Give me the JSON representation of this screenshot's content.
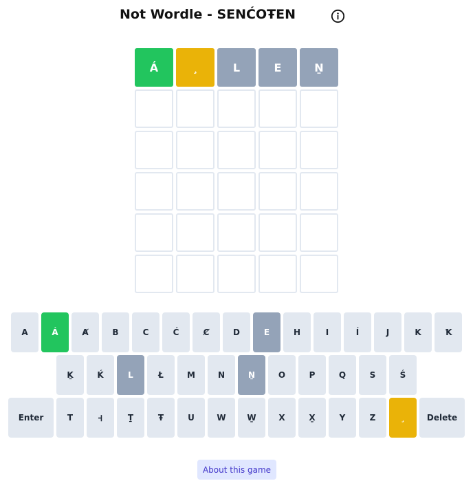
{
  "header": {
    "title": "Not Wordle - SENĆOŦEN",
    "info_icon": "info-circle-icon"
  },
  "colors": {
    "correct": "#22c55e",
    "present": "#eab308",
    "absent": "#94a3b8",
    "key_default": "#e2e8f0",
    "empty_border": "#e2e8f0",
    "about_bg": "#e0e7ff",
    "about_text": "#4338ca"
  },
  "board": {
    "rows": [
      [
        {
          "letter": "Á",
          "state": "correct"
        },
        {
          "letter": "¸",
          "state": "present"
        },
        {
          "letter": "L",
          "state": "absent"
        },
        {
          "letter": "E",
          "state": "absent"
        },
        {
          "letter": "Ṉ",
          "state": "absent"
        }
      ],
      [
        {
          "letter": "",
          "state": "empty"
        },
        {
          "letter": "",
          "state": "empty"
        },
        {
          "letter": "",
          "state": "empty"
        },
        {
          "letter": "",
          "state": "empty"
        },
        {
          "letter": "",
          "state": "empty"
        }
      ],
      [
        {
          "letter": "",
          "state": "empty"
        },
        {
          "letter": "",
          "state": "empty"
        },
        {
          "letter": "",
          "state": "empty"
        },
        {
          "letter": "",
          "state": "empty"
        },
        {
          "letter": "",
          "state": "empty"
        }
      ],
      [
        {
          "letter": "",
          "state": "empty"
        },
        {
          "letter": "",
          "state": "empty"
        },
        {
          "letter": "",
          "state": "empty"
        },
        {
          "letter": "",
          "state": "empty"
        },
        {
          "letter": "",
          "state": "empty"
        }
      ],
      [
        {
          "letter": "",
          "state": "empty"
        },
        {
          "letter": "",
          "state": "empty"
        },
        {
          "letter": "",
          "state": "empty"
        },
        {
          "letter": "",
          "state": "empty"
        },
        {
          "letter": "",
          "state": "empty"
        }
      ],
      [
        {
          "letter": "",
          "state": "empty"
        },
        {
          "letter": "",
          "state": "empty"
        },
        {
          "letter": "",
          "state": "empty"
        },
        {
          "letter": "",
          "state": "empty"
        },
        {
          "letter": "",
          "state": "empty"
        }
      ]
    ]
  },
  "keyboard": {
    "rows": [
      [
        {
          "label": "A",
          "state": "default"
        },
        {
          "label": "Á",
          "state": "correct"
        },
        {
          "label": "Ⱥ",
          "state": "default"
        },
        {
          "label": "B",
          "state": "default"
        },
        {
          "label": "C",
          "state": "default"
        },
        {
          "label": "Ć",
          "state": "default"
        },
        {
          "label": "Ȼ",
          "state": "default"
        },
        {
          "label": "D",
          "state": "default"
        },
        {
          "label": "E",
          "state": "absent"
        },
        {
          "label": "H",
          "state": "default"
        },
        {
          "label": "I",
          "state": "default"
        },
        {
          "label": "Í",
          "state": "default"
        },
        {
          "label": "J",
          "state": "default"
        },
        {
          "label": "K",
          "state": "default"
        },
        {
          "label": "Ꝁ",
          "state": "default"
        }
      ],
      [
        {
          "label": "Ḵ",
          "state": "default"
        },
        {
          "label": "Ḱ",
          "state": "default"
        },
        {
          "label": "L",
          "state": "absent"
        },
        {
          "label": "Ł",
          "state": "default"
        },
        {
          "label": "M",
          "state": "default"
        },
        {
          "label": "N",
          "state": "default"
        },
        {
          "label": "Ṉ",
          "state": "absent"
        },
        {
          "label": "O",
          "state": "default"
        },
        {
          "label": "P",
          "state": "default"
        },
        {
          "label": "Q",
          "state": "default"
        },
        {
          "label": "S",
          "state": "default"
        },
        {
          "label": "Ś",
          "state": "default"
        }
      ],
      [
        {
          "label": "Enter",
          "state": "default",
          "wide": true
        },
        {
          "label": "T",
          "state": "default"
        },
        {
          "label": "Ꟶ",
          "state": "default"
        },
        {
          "label": "Ṯ",
          "state": "default"
        },
        {
          "label": "Ŧ",
          "state": "default"
        },
        {
          "label": "U",
          "state": "default"
        },
        {
          "label": "W",
          "state": "default"
        },
        {
          "label": "W̱",
          "state": "default"
        },
        {
          "label": "X",
          "state": "default"
        },
        {
          "label": "X̱",
          "state": "default"
        },
        {
          "label": "Y",
          "state": "default"
        },
        {
          "label": "Z",
          "state": "default"
        },
        {
          "label": "¸",
          "state": "present"
        },
        {
          "label": "Delete",
          "state": "default",
          "wide": true
        }
      ]
    ]
  },
  "footer": {
    "about_label": "About this game"
  }
}
